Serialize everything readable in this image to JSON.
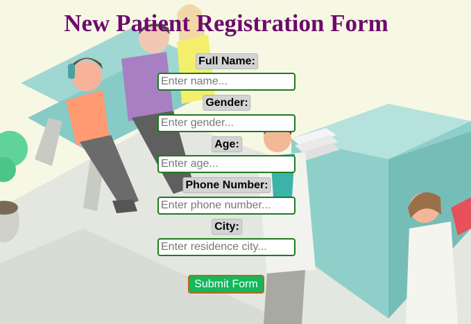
{
  "page": {
    "title": "New Patient Registration Form"
  },
  "form": {
    "fields": [
      {
        "label": "Full Name:",
        "placeholder": "Enter name..."
      },
      {
        "label": "Gender:",
        "placeholder": "Enter gender..."
      },
      {
        "label": "Age:",
        "placeholder": "Enter age..."
      },
      {
        "label": "Phone Number:",
        "placeholder": "Enter phone number..."
      },
      {
        "label": "City:",
        "placeholder": "Enter residence city..."
      }
    ],
    "submit_label": "Submit Form"
  },
  "colors": {
    "title": "#6d0b6d",
    "label_bg": "#d3d3d3",
    "input_border": "#1e7a1e",
    "button_bg": "#12b85a",
    "button_border": "#b26a13"
  }
}
